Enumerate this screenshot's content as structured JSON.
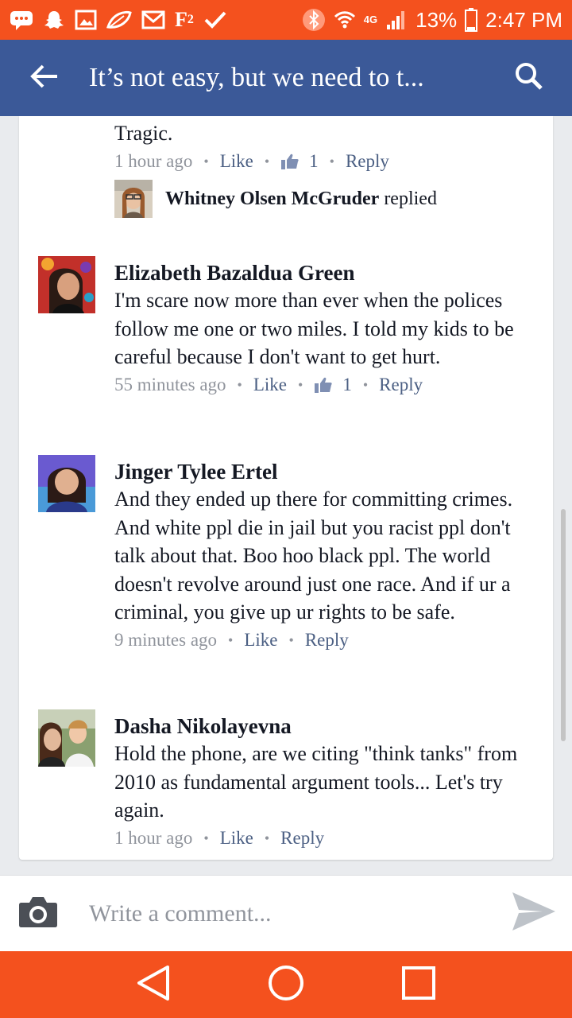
{
  "status_bar": {
    "battery": "13%",
    "time": "2:47 PM",
    "network": "4G",
    "icons": [
      "messenger-icon",
      "snapchat-icon",
      "gallery-icon",
      "leaf-icon",
      "gmail-icon",
      "f2-icon",
      "check-icon",
      "bluetooth-icon",
      "wifi-icon",
      "signal-icon",
      "battery-icon"
    ],
    "f2_label": "F",
    "f2_sub": "2"
  },
  "app_bar": {
    "title": "It’s not easy, but we need to t...",
    "back_icon": "arrow-left-icon",
    "search_icon": "search-icon"
  },
  "comments": [
    {
      "text": "Tragic.",
      "time": "1 hour ago",
      "like_label": "Like",
      "like_count": "1",
      "reply_label": "Reply",
      "reply_preview": {
        "name": "Whitney Olsen McGruder",
        "action": "replied"
      }
    },
    {
      "author": "Elizabeth Bazaldua Green",
      "text": "I'm scare now more than ever when the polices follow me one or two miles.  I told my kids to be careful because I don't want to get hurt.",
      "time": "55 minutes ago",
      "like_label": "Like",
      "like_count": "1",
      "reply_label": "Reply"
    },
    {
      "author": "Jinger Tylee Ertel",
      "text": "And they ended up there for committing crimes. And white ppl die in jail but you racist ppl don't talk about that. Boo hoo black ppl. The world doesn't revolve around just one race. And if ur a criminal, you give up ur rights to be safe.",
      "time": "9 minutes ago",
      "like_label": "Like",
      "reply_label": "Reply"
    },
    {
      "author": "Dasha Nikolayevna",
      "text": "Hold the phone, are we citing \"think tanks\" from 2010 as fundamental argument tools... Let's try again.",
      "time": "1 hour ago",
      "like_label": "Like",
      "reply_label": "Reply"
    }
  ],
  "composer": {
    "placeholder": "Write a comment...",
    "camera_icon": "camera-icon",
    "send_icon": "send-icon"
  },
  "nav_bar": {
    "back_icon": "nav-back-icon",
    "home_icon": "nav-home-icon",
    "recents_icon": "nav-recents-icon"
  },
  "colors": {
    "status_bar": "#f4511e",
    "app_bar": "#3b5998",
    "link": "#4b5f83",
    "meta": "#90949c",
    "background": "#e9ebee"
  }
}
